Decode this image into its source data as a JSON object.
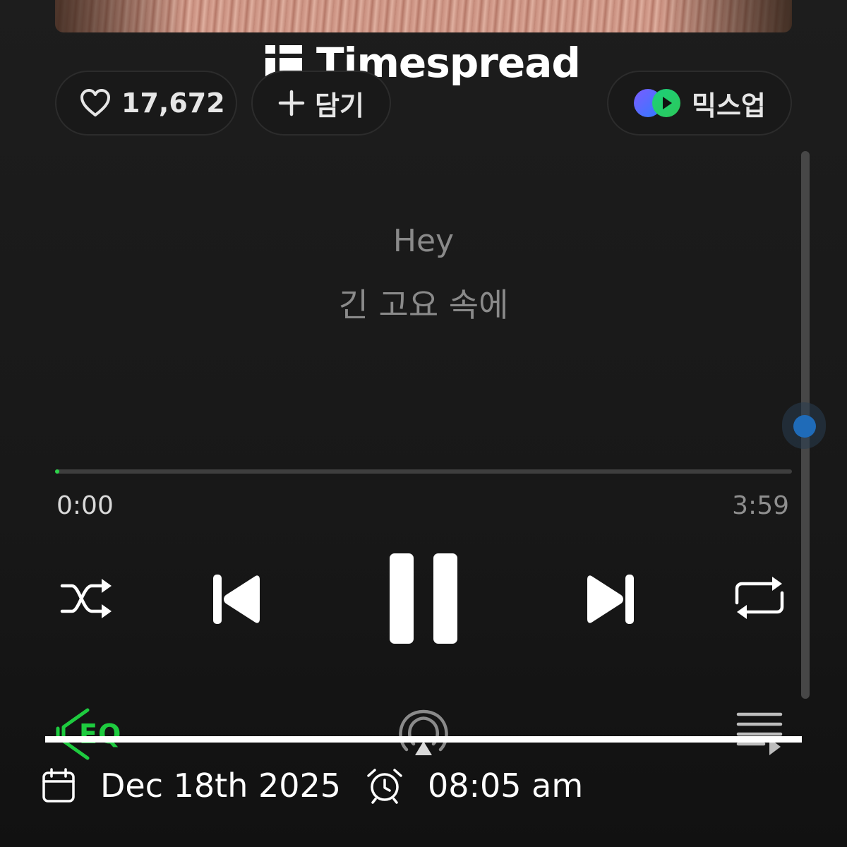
{
  "watermark": {
    "brand": "Timespread"
  },
  "actions": {
    "like_count": "17,672",
    "add_label": "담기",
    "mixup_label": "믹스업"
  },
  "lyrics": {
    "line1": "Hey",
    "line2": "긴 고요 속에"
  },
  "player": {
    "current_time": "0:00",
    "total_time": "3:59",
    "progress_fraction": 0.004,
    "state": "playing"
  },
  "bottom_bar": {
    "equalizer_label": "EQ"
  },
  "footer": {
    "date": "Dec 18th 2025",
    "time": "08:05 am"
  },
  "colors": {
    "accent_green": "#2dd34a",
    "equalizer_green": "#1ecb3f",
    "scroll_dot_blue": "#1f6bb8",
    "background": "#181818"
  },
  "icons": {
    "like": "heart-icon",
    "add": "plus-icon",
    "mixup": "mixup-logo-icon",
    "shuffle": "shuffle-icon",
    "previous": "skip-previous-icon",
    "pause": "pause-icon",
    "next": "skip-next-icon",
    "repeat": "repeat-icon",
    "equalizer": "equalizer-icon",
    "airplay": "airplay-icon",
    "queue": "playlist-queue-icon",
    "date": "calendar-icon",
    "time": "alarm-clock-icon"
  }
}
